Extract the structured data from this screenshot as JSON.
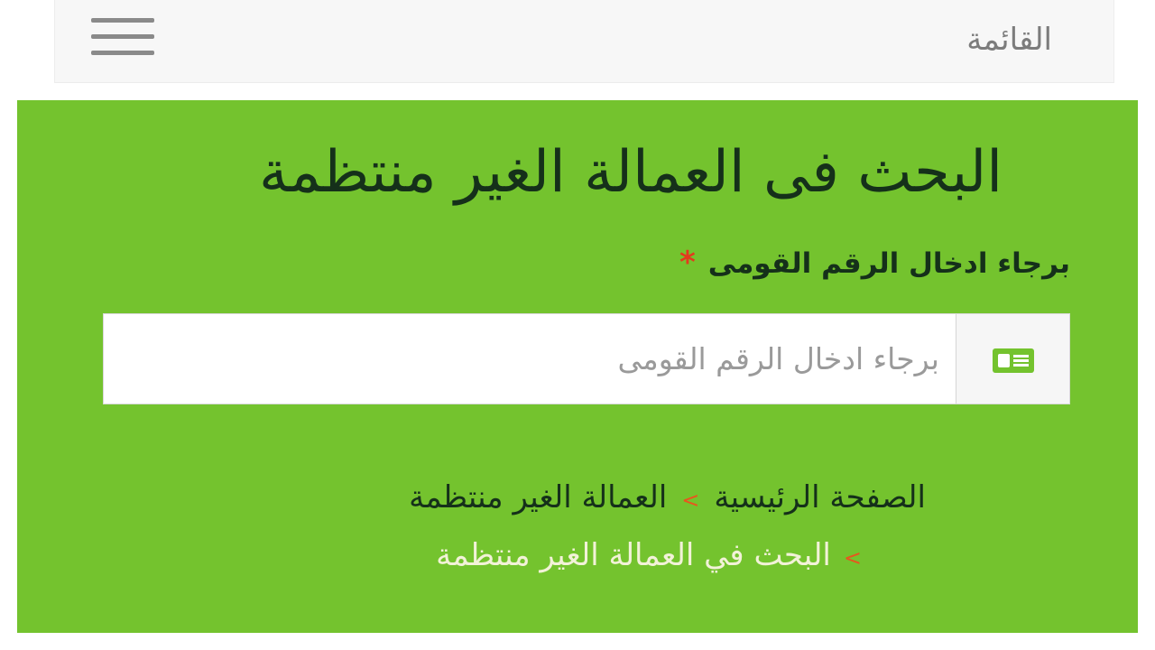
{
  "nav": {
    "menu_label": "القائمة",
    "menu_icon": "hamburger-menu-icon"
  },
  "page": {
    "title": "البحث فى العمالة الغير منتظمة",
    "field_label": "برجاء ادخال الرقم القومى",
    "required_mark": "*",
    "input_placeholder": "برجاء ادخال الرقم القومى",
    "input_value": "",
    "input_icon": "id-card-icon"
  },
  "breadcrumb": {
    "home": "الصفحة الرئيسية",
    "separator": ">",
    "section": "العمالة الغير منتظمة",
    "current": "البحث في العمالة الغير منتظمة"
  },
  "colors": {
    "panel_bg": "#74c32e",
    "title_text": "#15301a",
    "required": "#e43a1d",
    "separator": "#e8561e",
    "current_crumb": "#f2f2d8",
    "navbar_bg": "#f7f7f7"
  }
}
